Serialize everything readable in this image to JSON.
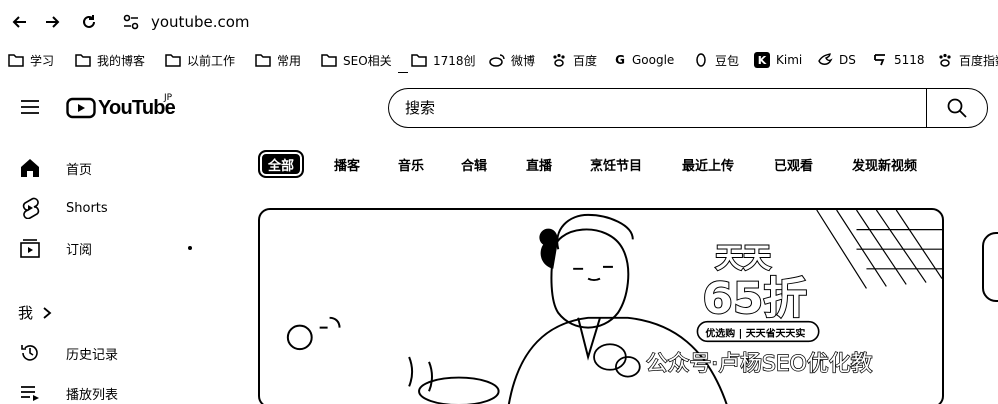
{
  "browser": {
    "url": "youtube.com",
    "icons": [
      "back-arrow-icon",
      "forward-arrow-icon",
      "reload-icon",
      "site-settings-icon"
    ]
  },
  "bookmarks": [
    {
      "label": "学习",
      "icon": "folder-icon"
    },
    {
      "label": "我的博客",
      "icon": "folder-icon"
    },
    {
      "label": "以前工作",
      "icon": "folder-icon"
    },
    {
      "label": "常用",
      "icon": "folder-icon"
    },
    {
      "label": "SEO相关",
      "icon": "folder-icon"
    },
    {
      "label": "1718创",
      "icon": "folder-icon"
    },
    {
      "label": "微博",
      "icon": "weibo-icon"
    },
    {
      "label": "百度",
      "icon": "baidu-paw-icon"
    },
    {
      "label": "Google",
      "icon": "google-icon"
    },
    {
      "label": "豆包",
      "icon": "doubao-icon"
    },
    {
      "label": "Kimi",
      "icon": "kimi-icon"
    },
    {
      "label": "DS",
      "icon": "deepseek-icon"
    },
    {
      "label": "5118",
      "icon": "5118-icon"
    },
    {
      "label": "百度指数",
      "icon": "baidu-paw-icon"
    }
  ],
  "youtube": {
    "logo_text": "YouTube",
    "country_code": "JP",
    "search_placeholder": "搜索"
  },
  "sidebar": {
    "items": [
      {
        "label": "首页",
        "icon": "home-icon"
      },
      {
        "label": "Shorts",
        "icon": "shorts-icon"
      },
      {
        "label": "订阅",
        "icon": "subscriptions-icon"
      }
    ],
    "me_label": "我",
    "me_items": [
      {
        "label": "历史记录",
        "icon": "history-icon"
      },
      {
        "label": "播放列表",
        "icon": "playlist-icon"
      }
    ]
  },
  "chips": [
    "全部",
    "播客",
    "音乐",
    "合辑",
    "直播",
    "烹饪节目",
    "最近上传",
    "已观看",
    "发现新视频"
  ],
  "thumbnail": {
    "badge_line1": "天天",
    "badge_line2": "65折",
    "badge_tag": "优选购 | 天天省天天实",
    "watermark": "公众号·卢杨SEO优化教"
  }
}
